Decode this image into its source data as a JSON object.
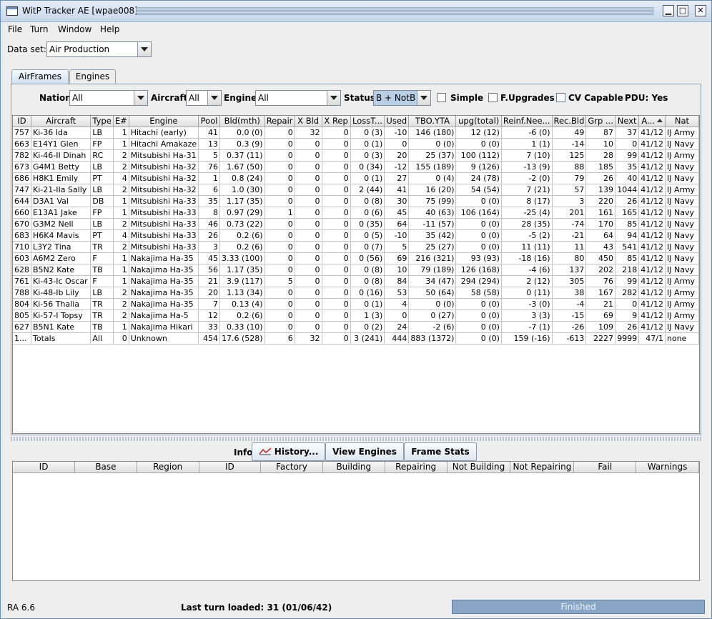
{
  "window": {
    "title": "WitP Tracker AE [wpae008]"
  },
  "menu": [
    "File",
    "Turn",
    "Window",
    "Help"
  ],
  "dataset": {
    "label": "Data set:",
    "value": "Air Production"
  },
  "tabs": [
    "AirFrames",
    "Engines"
  ],
  "filters": {
    "nation_label": "Nation:",
    "nation_value": "All",
    "aircraft_label": "Aircraft:",
    "aircraft_value": "All",
    "engine_label": "Engine:",
    "engine_value": "All",
    "status_label": "Status:",
    "status_value": "B + NotB",
    "simple_label": "Simple",
    "fupgrades_label": "F.Upgrades",
    "cvcapable_label": "CV Capable",
    "pdu_label": "PDU: Yes"
  },
  "table": {
    "columns": [
      "ID",
      "Aircraft",
      "Type",
      "E#",
      "Engine",
      "Pool",
      "Bld(mth)",
      "Repair",
      "X Bld",
      "X Rep",
      "LossT...",
      "Used",
      "TBO.YTA",
      "upg(total)",
      "Reinf.Nee...",
      "Rec.Bld",
      "Grp ...",
      "Next",
      "A...",
      "Nat"
    ],
    "rows": [
      [
        "757",
        "Ki-36 Ida",
        "LB",
        "1",
        "Hitachi (early)",
        "41",
        "0.0 (0)",
        "0",
        "32",
        "0",
        "0 (3)",
        "-10",
        "146 (180)",
        "12 (12)",
        "-6 (0)",
        "49",
        "87",
        "37",
        "41/12",
        "IJ Army"
      ],
      [
        "663",
        "E14Y1 Glen",
        "FP",
        "1",
        "Hitachi Amakaze",
        "13",
        "0.3 (9)",
        "0",
        "0",
        "0",
        "0 (1)",
        "0",
        "0 (0)",
        "0 (0)",
        "1 (1)",
        "-14",
        "10",
        "0",
        "41/12",
        "IJ Navy"
      ],
      [
        "782",
        "Ki-46-II Dinah",
        "RC",
        "2",
        "Mitsubishi Ha-31",
        "5",
        "0.37 (11)",
        "0",
        "0",
        "0",
        "0 (3)",
        "20",
        "25 (37)",
        "100 (112)",
        "7 (10)",
        "125",
        "28",
        "99",
        "41/12",
        "IJ Army"
      ],
      [
        "673",
        "G4M1 Betty",
        "LB",
        "2",
        "Mitsubishi Ha-32",
        "76",
        "1.67 (50)",
        "0",
        "0",
        "0",
        "0 (34)",
        "-12",
        "155 (189)",
        "9 (126)",
        "-13 (9)",
        "88",
        "185",
        "35",
        "41/12",
        "IJ Navy"
      ],
      [
        "686",
        "H8K1 Emily",
        "PT",
        "4",
        "Mitsubishi Ha-32",
        "1",
        "0.8 (24)",
        "0",
        "0",
        "0",
        "0 (1)",
        "27",
        "0 (4)",
        "24 (78)",
        "-2 (0)",
        "79",
        "26",
        "40",
        "41/12",
        "IJ Navy"
      ],
      [
        "747",
        "Ki-21-IIa Sally",
        "LB",
        "2",
        "Mitsubishi Ha-32",
        "6",
        "1.0 (30)",
        "0",
        "0",
        "0",
        "2 (44)",
        "41",
        "16 (20)",
        "54 (54)",
        "7 (21)",
        "57",
        "139",
        "1044",
        "41/12",
        "IJ Army"
      ],
      [
        "644",
        "D3A1 Val",
        "DB",
        "1",
        "Mitsubishi Ha-33",
        "35",
        "1.17 (35)",
        "0",
        "0",
        "0",
        "0 (8)",
        "30",
        "75 (99)",
        "0 (0)",
        "8 (17)",
        "3",
        "220",
        "26",
        "41/12",
        "IJ Navy"
      ],
      [
        "660",
        "E13A1 Jake",
        "FP",
        "1",
        "Mitsubishi Ha-33",
        "8",
        "0.97 (29)",
        "1",
        "0",
        "0",
        "0 (6)",
        "45",
        "40 (63)",
        "106 (164)",
        "-25 (4)",
        "201",
        "161",
        "165",
        "41/12",
        "IJ Navy"
      ],
      [
        "670",
        "G3M2 Nell",
        "LB",
        "2",
        "Mitsubishi Ha-33",
        "46",
        "0.73 (22)",
        "0",
        "0",
        "0",
        "0 (35)",
        "64",
        "-11 (57)",
        "0 (0)",
        "28 (35)",
        "-74",
        "170",
        "85",
        "41/12",
        "IJ Navy"
      ],
      [
        "683",
        "H6K4 Mavis",
        "PT",
        "4",
        "Mitsubishi Ha-33",
        "26",
        "0.2 (6)",
        "0",
        "0",
        "0",
        "0 (5)",
        "-10",
        "35 (42)",
        "0 (0)",
        "-5 (2)",
        "-21",
        "64",
        "94",
        "41/12",
        "IJ Navy"
      ],
      [
        "710",
        "L3Y2 Tina",
        "TR",
        "2",
        "Mitsubishi Ha-33",
        "3",
        "0.2 (6)",
        "0",
        "0",
        "0",
        "0 (7)",
        "5",
        "25 (27)",
        "0 (0)",
        "11 (11)",
        "11",
        "43",
        "541",
        "41/12",
        "IJ Navy"
      ],
      [
        "603",
        "A6M2 Zero",
        "F",
        "1",
        "Nakajima Ha-35",
        "45",
        "3.33 (100)",
        "0",
        "0",
        "0",
        "0 (56)",
        "69",
        "216 (321)",
        "93 (93)",
        "-18 (16)",
        "80",
        "450",
        "85",
        "41/12",
        "IJ Navy"
      ],
      [
        "628",
        "B5N2 Kate",
        "TB",
        "1",
        "Nakajima Ha-35",
        "56",
        "1.17 (35)",
        "0",
        "0",
        "0",
        "0 (8)",
        "10",
        "79 (189)",
        "126 (168)",
        "-4 (6)",
        "137",
        "202",
        "218",
        "41/12",
        "IJ Navy"
      ],
      [
        "761",
        "Ki-43-Ic Oscar",
        "F",
        "1",
        "Nakajima Ha-35",
        "21",
        "3.9 (117)",
        "5",
        "0",
        "0",
        "0 (8)",
        "84",
        "34 (47)",
        "294 (294)",
        "2 (12)",
        "305",
        "76",
        "99",
        "41/12",
        "IJ Army"
      ],
      [
        "788",
        "Ki-48-Ib Lily",
        "LB",
        "2",
        "Nakajima Ha-35",
        "20",
        "1.13 (34)",
        "0",
        "0",
        "0",
        "0 (16)",
        "53",
        "50 (64)",
        "58 (58)",
        "0 (11)",
        "38",
        "167",
        "282",
        "41/12",
        "IJ Army"
      ],
      [
        "804",
        "Ki-56 Thalia",
        "TR",
        "2",
        "Nakajima Ha-35",
        "7",
        "0.13 (4)",
        "0",
        "0",
        "0",
        "0 (1)",
        "4",
        "0 (0)",
        "0 (0)",
        "-3 (0)",
        "-4",
        "21",
        "0",
        "41/12",
        "IJ Army"
      ],
      [
        "805",
        "Ki-57-I Topsy",
        "TR",
        "2",
        "Nakajima Ha-5",
        "12",
        "0.2 (6)",
        "0",
        "0",
        "0",
        "1 (3)",
        "0",
        "0 (27)",
        "0 (0)",
        "3 (3)",
        "-15",
        "69",
        "9",
        "41/12",
        "IJ Army"
      ],
      [
        "627",
        "B5N1 Kate",
        "TB",
        "1",
        "Nakajima Hikari",
        "33",
        "0.33 (10)",
        "0",
        "0",
        "0",
        "0 (2)",
        "24",
        "-2 (6)",
        "0 (0)",
        "-7 (1)",
        "-26",
        "109",
        "26",
        "41/12",
        "IJ Navy"
      ],
      [
        "1...",
        "Totals",
        "All",
        "0",
        "Unknown",
        "454",
        "17.6 (528)",
        "6",
        "32",
        "0",
        "3 (241)",
        "444",
        "883 (1372)",
        "0 (0)",
        "159 (-16)",
        "-613",
        "2227",
        "9999",
        "47/1",
        "none"
      ]
    ]
  },
  "info": {
    "label": "Info:",
    "history": "History...",
    "view_engines": "View Engines",
    "frame_stats": "Frame Stats"
  },
  "lower_table": {
    "columns": [
      "ID",
      "Base",
      "Region",
      "ID",
      "Factory",
      "Building",
      "Repairing",
      "Not Building",
      "Not Repairing",
      "Fail",
      "Warnings"
    ]
  },
  "status": {
    "version": "RA 6.6",
    "last_turn": "Last turn loaded: 31 (01/06/42)",
    "progress": "Finished"
  }
}
